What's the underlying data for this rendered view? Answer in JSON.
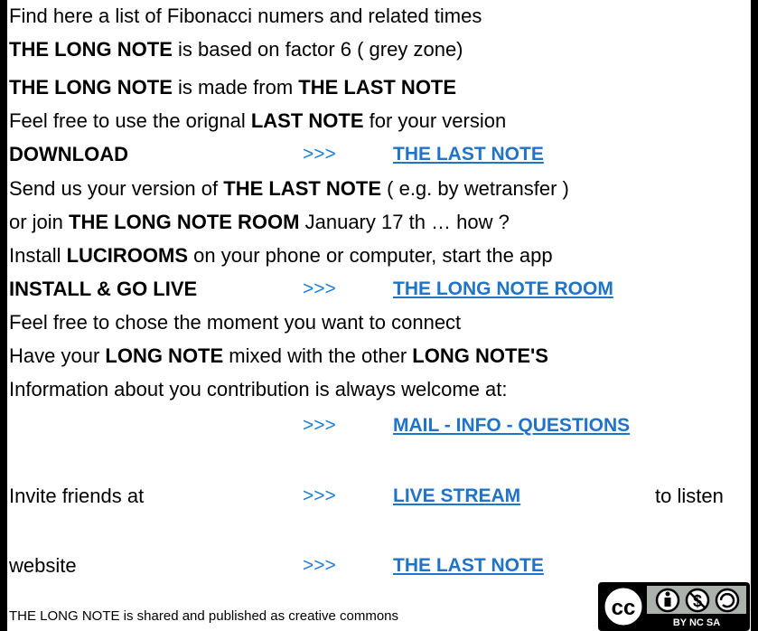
{
  "lines": {
    "l1": "Find here a list of Fibonacci numers and related times",
    "l2_bold": "THE LONG NOTE",
    "l2_rest": " is based on factor 6 ( grey zone)",
    "l3_bold1": "THE LONG NOTE",
    "l3_mid": " is made from ",
    "l3_bold2": "THE LAST NOTE",
    "l4_pre": "Feel free to use the orignal ",
    "l4_bold": "LAST NOTE",
    "l4_post": " for your version",
    "l6_pre": "Send us your version of ",
    "l6_bold": "THE LAST NOTE",
    "l6_post": " ( e.g. by wetransfer )",
    "l7_pre": "or join ",
    "l7_bold": "THE LONG NOTE ROOM",
    "l7_post": " January 17 th … how ?",
    "l8_pre": "Install ",
    "l8_bold": "LUCIROOMS",
    "l8_post": " on your phone or computer, start the app",
    "l10": "Feel free to chose the moment you want to connect",
    "l11_pre": "Have your ",
    "l11_bold1": "LONG NOTE",
    "l11_mid": " mixed with the other ",
    "l11_bold2": "LONG NOTE'S",
    "l12": "Information about you contribution is always welcome at:"
  },
  "download": {
    "label": "DOWNLOAD",
    "arrow": ">>>",
    "link": "THE LAST NOTE"
  },
  "install": {
    "label": "INSTALL & GO LIVE",
    "arrow": ">>>",
    "link": "THE LONG NOTE ROOM"
  },
  "mail": {
    "arrow": ">>>",
    "link": "MAIL -  INFO - QUESTIONS"
  },
  "invite": {
    "label": "Invite friends at",
    "arrow": ">>>",
    "link": "LIVE STREAM",
    "tail": "to listen"
  },
  "website": {
    "label": "website",
    "arrow": ">>>",
    "link": "THE LAST NOTE"
  },
  "footer": "THE LONG NOTE is shared and published as creative commons",
  "license_badge": {
    "icon": "cc-by-nc-sa-icon",
    "text": "BY  NC  SA"
  },
  "colors": {
    "link": "#1f73c8",
    "arrow": "#1f7fd6"
  }
}
